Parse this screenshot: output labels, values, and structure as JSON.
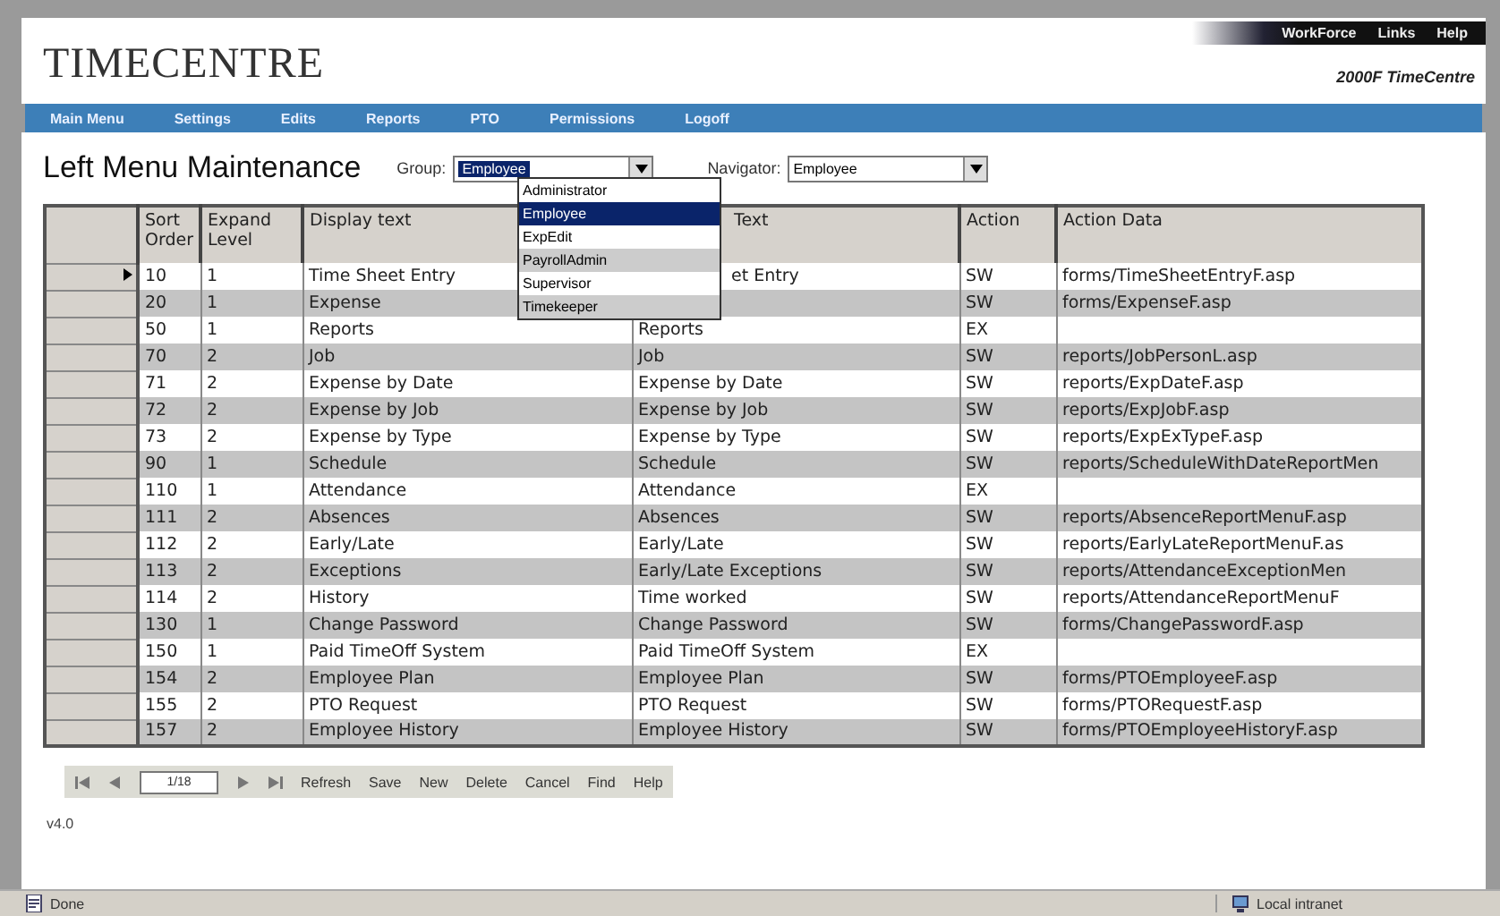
{
  "header": {
    "logo": "TIMECENTRE",
    "top_links": [
      "WorkForce",
      "Links",
      "Help"
    ],
    "product": "2000F TimeCentre"
  },
  "nav": [
    "Main Menu",
    "Settings",
    "Edits",
    "Reports",
    "PTO",
    "Permissions",
    "Logoff"
  ],
  "page_title": "Left Menu Maintenance",
  "group": {
    "label": "Group:",
    "value": "Employee",
    "options": [
      {
        "label": "Administrator",
        "selected": false
      },
      {
        "label": "Employee",
        "selected": true
      },
      {
        "label": "ExpEdit",
        "selected": false
      },
      {
        "label": "PayrollAdmin",
        "selected": false
      },
      {
        "label": "Supervisor",
        "selected": false
      },
      {
        "label": "Timekeeper",
        "selected": false
      }
    ]
  },
  "navigator": {
    "label": "Navigator:",
    "value": "Employee"
  },
  "table": {
    "columns": [
      "Sort Order",
      "Expand Level",
      "Display text",
      "Text",
      "Action",
      "Action Data"
    ],
    "rows": [
      {
        "selected": true,
        "cells": [
          "10",
          "1",
          "Time Sheet Entry",
          "et Entry",
          "SW",
          "forms/TimeSheetEntryF.asp"
        ]
      },
      {
        "selected": false,
        "cells": [
          "20",
          "1",
          "Expense",
          null,
          "SW",
          "forms/ExpenseF.asp"
        ]
      },
      {
        "selected": false,
        "cells": [
          "50",
          "1",
          "Reports",
          "Reports",
          "EX",
          null
        ]
      },
      {
        "selected": false,
        "cells": [
          "70",
          "2",
          "Job",
          "Job",
          "SW",
          "reports/JobPersonL.asp"
        ]
      },
      {
        "selected": false,
        "cells": [
          "71",
          "2",
          "Expense by Date",
          "Expense by Date",
          "SW",
          "reports/ExpDateF.asp"
        ]
      },
      {
        "selected": false,
        "cells": [
          "72",
          "2",
          "Expense by Job",
          "Expense by Job",
          "SW",
          "reports/ExpJobF.asp"
        ]
      },
      {
        "selected": false,
        "cells": [
          "73",
          "2",
          "Expense by Type",
          "Expense by Type",
          "SW",
          "reports/ExpExTypeF.asp"
        ]
      },
      {
        "selected": false,
        "cells": [
          "90",
          "1",
          "Schedule",
          "Schedule",
          "SW",
          "reports/ScheduleWithDateReportMen"
        ]
      },
      {
        "selected": false,
        "cells": [
          "110",
          "1",
          "Attendance",
          "Attendance",
          "EX",
          null
        ]
      },
      {
        "selected": false,
        "cells": [
          "111",
          "2",
          "Absences",
          "Absences",
          "SW",
          "reports/AbsenceReportMenuF.asp"
        ]
      },
      {
        "selected": false,
        "cells": [
          "112",
          "2",
          "Early/Late",
          "Early/Late",
          "SW",
          "reports/EarlyLateReportMenuF.as"
        ]
      },
      {
        "selected": false,
        "cells": [
          "113",
          "2",
          "Exceptions",
          "Early/Late Exceptions",
          "SW",
          "reports/AttendanceExceptionMen"
        ]
      },
      {
        "selected": false,
        "cells": [
          "114",
          "2",
          "History",
          "Time worked",
          "SW",
          "reports/AttendanceReportMenuF"
        ]
      },
      {
        "selected": false,
        "cells": [
          "130",
          "1",
          "Change Password",
          "Change Password",
          "SW",
          "forms/ChangePasswordF.asp"
        ]
      },
      {
        "selected": false,
        "cells": [
          "150",
          "1",
          "Paid TimeOff System",
          "Paid TimeOff System",
          "EX",
          null
        ]
      },
      {
        "selected": false,
        "cells": [
          "154",
          "2",
          "Employee Plan",
          "Employee Plan",
          "SW",
          "forms/PTOEmployeeF.asp"
        ]
      },
      {
        "selected": false,
        "cells": [
          "155",
          "2",
          "PTO Request",
          "PTO Request",
          "SW",
          "forms/PTORequestF.asp"
        ]
      },
      {
        "selected": false,
        "cells": [
          "157",
          "2",
          "Employee History",
          "Employee History",
          "SW",
          "forms/PTOEmployeeHistoryF.asp"
        ]
      }
    ]
  },
  "toolbar": {
    "record": "1/18",
    "buttons": [
      "Refresh",
      "Save",
      "New",
      "Delete",
      "Cancel",
      "Find",
      "Help"
    ]
  },
  "version": "v4.0",
  "status_bar": {
    "text": "Done",
    "zone": "Local intranet"
  }
}
